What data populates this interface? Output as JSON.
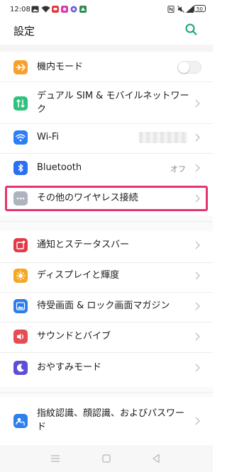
{
  "status_bar": {
    "time": "12:08",
    "battery": "50",
    "left_icons": [
      "gallery-icon",
      "wifi-icon",
      "line-icon",
      "app-icon",
      "app-icon",
      "app-icon"
    ],
    "right_icons": [
      "nfc-icon",
      "mute-icon",
      "signal-icon",
      "battery-icon"
    ]
  },
  "header": {
    "title": "設定",
    "search_icon": "search-icon"
  },
  "colors": {
    "accent": "#16a37b",
    "highlight_border": "#e8336d",
    "airplane": "#f7a12b",
    "dual_sim": "#2ec27e",
    "wifi": "#2d7df6",
    "bluetooth": "#2d6ff4",
    "other_wireless": "#aeb4bd",
    "notification": "#e23a46",
    "display": "#f5a623",
    "wallpaper": "#2b7de9",
    "sound": "#e54d52",
    "dnd": "#5b4fd6",
    "fingerprint": "#2f80ed"
  },
  "settings": {
    "airplane_mode": {
      "label": "機内モード",
      "icon": "airplane-icon",
      "toggle_on": false
    },
    "dual_sim": {
      "label_line1": "デュアル SIM & モバイルネットワー",
      "label_line2": "ク",
      "icon": "dual-sim-icon"
    },
    "wifi": {
      "label": "Wi-Fi",
      "icon": "wifi-icon"
    },
    "bluetooth": {
      "label": "Bluetooth",
      "value": "オフ",
      "icon": "bluetooth-icon"
    },
    "other_wireless": {
      "label": "その他のワイヤレス接続",
      "icon": "more-dots-icon"
    },
    "notification_bar": {
      "label": "通知とステータスバー",
      "icon": "notification-icon"
    },
    "display": {
      "label": "ディスプレイと輝度",
      "icon": "brightness-icon"
    },
    "wallpaper": {
      "label": "待受画面 & ロック画面マガジン",
      "icon": "wallpaper-icon"
    },
    "sound": {
      "label": "サウンドとバイブ",
      "icon": "sound-icon"
    },
    "dnd": {
      "label": "おやすみモード",
      "icon": "moon-icon"
    },
    "biometrics": {
      "label_line1": "指紋認識、顔認識、およびパスワー",
      "label_line2": "ド",
      "icon": "fingerprint-icon"
    }
  },
  "nav_bar": {
    "items": [
      "menu-icon",
      "home-icon",
      "back-icon"
    ]
  }
}
